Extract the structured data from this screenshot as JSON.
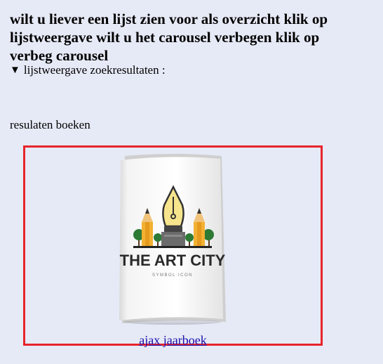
{
  "instructions": {
    "text": "wilt u liever een lijst zien voor als overzicht klik op lijstweergave wilt u het carousel verbegen klik op verbeg carousel"
  },
  "list_view": {
    "toggle_symbol": "▼",
    "label": "lijstweergave zoekresultaten :"
  },
  "results": {
    "label": "resulaten boeken",
    "books": [
      {
        "cover_title": "THE ART CITY",
        "cover_subtitle": "SYMBOL ICON",
        "link_text": "ajax jaarboek"
      }
    ]
  },
  "colors": {
    "page_background": "#e6eaf6",
    "carousel_border": "#e8242b",
    "link": "#1a0dab"
  }
}
